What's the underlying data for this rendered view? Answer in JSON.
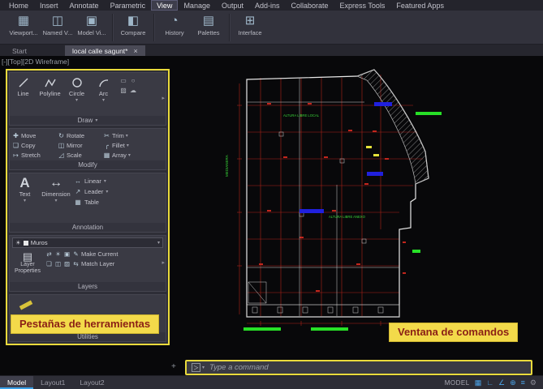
{
  "colors": {
    "highlight_yellow": "#e9da3c",
    "callout_bg": "#f3da4a",
    "callout_text": "#8b2016",
    "plan_red": "#c2261d",
    "plan_green": "#27e027",
    "plan_blue": "#2020dd",
    "plan_white": "#e8e8e8",
    "status_blue": "#4aa3e8"
  },
  "menubar": {
    "items": [
      "Home",
      "Insert",
      "Annotate",
      "Parametric",
      "View",
      "Manage",
      "Output",
      "Add-ins",
      "Collaborate",
      "Express Tools",
      "Featured Apps"
    ],
    "active": "View"
  },
  "ribbon": {
    "buttons": [
      {
        "label": "Viewport...",
        "glyph": "▦"
      },
      {
        "label": "Named V...",
        "glyph": "◫"
      },
      {
        "label": "Model Vi...",
        "glyph": "▣"
      },
      {
        "label": "Compare",
        "glyph": "◧"
      },
      {
        "label": "History",
        "glyph": "◔"
      },
      {
        "label": "Palettes",
        "glyph": "▤"
      },
      {
        "label": "Interface",
        "glyph": "⊞"
      }
    ]
  },
  "doc_tabs": {
    "start": "Start",
    "active_doc": "local calle sagunt*",
    "close": "×"
  },
  "viewport_label": "[-][Top][2D Wireframe]",
  "ui": {
    "caret_down": "▾",
    "caret_right": "▸",
    "prompt": "＞",
    "ucs_glyph": "+"
  },
  "panels": {
    "draw": {
      "label": "Draw",
      "buttons": [
        "Line",
        "Polyline",
        "Circle",
        "Arc"
      ],
      "side_glyphs": [
        "▭",
        "○",
        "▨",
        "☁"
      ]
    },
    "modify": {
      "label": "Modify",
      "buttons": [
        {
          "label": "Move",
          "glyph": "✚"
        },
        {
          "label": "Rotate",
          "glyph": "↻"
        },
        {
          "label": "Trim",
          "glyph": "✂"
        },
        {
          "label": "Copy",
          "glyph": "❏"
        },
        {
          "label": "Mirror",
          "glyph": "◫"
        },
        {
          "label": "Fillet",
          "glyph": "╭"
        },
        {
          "label": "Stretch",
          "glyph": "↦"
        },
        {
          "label": "Scale",
          "glyph": "◿"
        },
        {
          "label": "Array",
          "glyph": "▦"
        }
      ]
    },
    "annotation": {
      "label": "Annotation",
      "text_glyph": "A",
      "big": [
        "Text",
        "Dimension"
      ],
      "dim_glyph": "↔",
      "small": [
        {
          "label": "Linear",
          "glyph": "↔"
        },
        {
          "label": "Leader",
          "glyph": "↗"
        },
        {
          "label": "Table",
          "glyph": "▦"
        }
      ]
    },
    "layers": {
      "label": "Layers",
      "dropdown": "Muros",
      "drop_glyph": "☀",
      "properties": "Layer Properties",
      "properties_glyph": "▤",
      "row1_glyphs": [
        "⇄",
        "☀",
        "▣",
        "✎"
      ],
      "make_current": "Make Current",
      "row2_glyphs": [
        "❏",
        "◫",
        "▨",
        "⇆"
      ],
      "match_layer": "Match Layer"
    },
    "utilities": {
      "label": "Utilities"
    }
  },
  "callouts": {
    "tools": "Pestañas de herramientas",
    "command": "Ventana de comandos"
  },
  "command_line": {
    "placeholder": "Type a command"
  },
  "status": {
    "tabs": [
      "Model",
      "Layout1",
      "Layout2"
    ],
    "model_label": "MODEL",
    "icons": [
      {
        "glyph": "▦"
      },
      {
        "glyph": "∟"
      },
      {
        "glyph": "∠"
      },
      {
        "glyph": "⊕"
      },
      {
        "glyph": "≡"
      },
      {
        "glyph": "⚙"
      }
    ]
  },
  "plan_labels": {
    "medianera": "MEDIANERA",
    "altura_local": "ALTURA LIBRE LOCAL",
    "altura_anexo": "ALTURA LIBRE ANEXO"
  }
}
